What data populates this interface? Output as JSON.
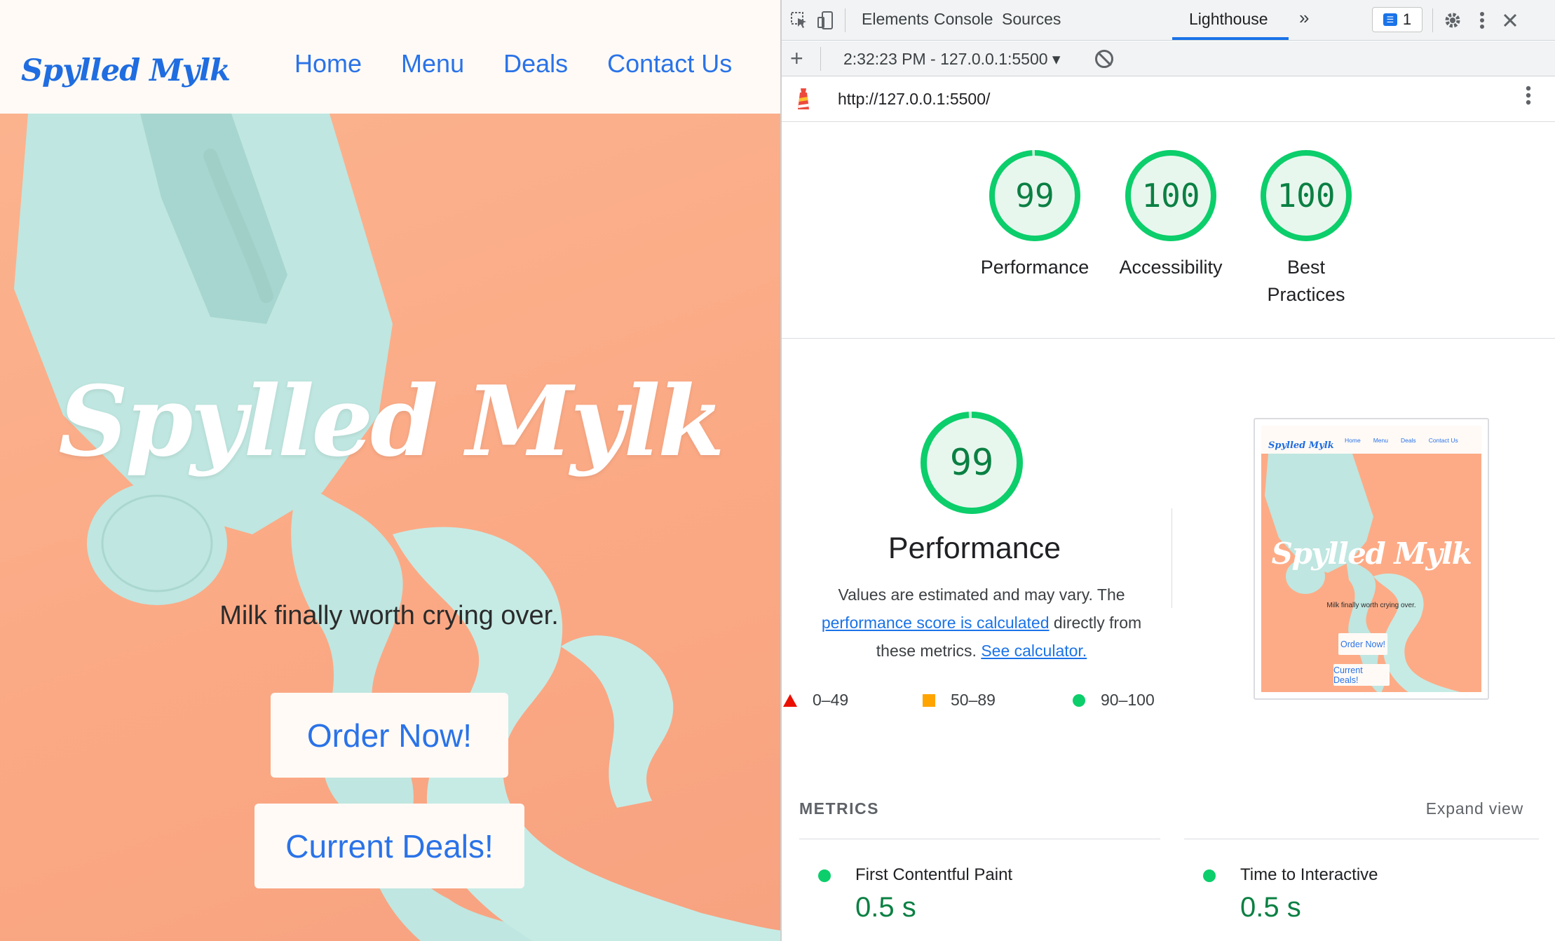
{
  "site": {
    "brand": "Spylled Mylk",
    "nav": [
      "Home",
      "Menu",
      "Deals",
      "Contact Us"
    ],
    "hero_title": "Spylled Mylk",
    "tagline": "Milk finally worth crying over.",
    "cta_order": "Order Now!",
    "cta_deals": "Current Deals!",
    "colors": {
      "brand_blue": "#2a73e8",
      "hero_peach": "#fdab86",
      "milk_blue": "#bfe6e0"
    }
  },
  "devtools": {
    "tabs": [
      "Elements",
      "Console",
      "Sources",
      "Lighthouse"
    ],
    "active_tab": "Lighthouse",
    "more_tabs": "»",
    "issues_count": "1",
    "report_selector": "2:32:23 PM - 127.0.0.1:5500 ▾",
    "url": "http://127.0.0.1:5500/",
    "scores": [
      {
        "label": "Performance",
        "value": "99",
        "fraction": 0.99
      },
      {
        "label": "Accessibility",
        "value": "100",
        "fraction": 1.0
      },
      {
        "label": "Best Practices",
        "value": "100",
        "fraction": 1.0
      }
    ],
    "perf_score": {
      "value": "99",
      "fraction": 0.99
    },
    "perf_title": "Performance",
    "perf_desc_1": "Values are estimated and may vary. The",
    "perf_desc_link1": "performance score is calculated",
    "perf_desc_2": "directly from",
    "perf_desc_3": "these metrics.",
    "perf_desc_link2": "See calculator.",
    "legend": [
      "0–49",
      "50–89",
      "90–100"
    ],
    "thumbnail": {
      "brand": "Spylled Mylk",
      "nav": [
        "Home",
        "Menu",
        "Deals",
        "Contact Us"
      ],
      "hero_title": "Spylled Mylk",
      "tagline": "Milk finally worth crying over.",
      "cta_order": "Order Now!",
      "cta_deals": "Current Deals!"
    },
    "metrics_heading": "METRICS",
    "expand_view": "Expand view",
    "metrics": [
      {
        "name": "First Contentful Paint",
        "value": "0.5 s"
      },
      {
        "name": "Time to Interactive",
        "value": "0.5 s"
      }
    ],
    "colors": {
      "pass_green": "#0cce6b",
      "pass_text": "#0b8043",
      "average": "#ffa400",
      "fail": "#eb0f00",
      "accent": "#1a73e8"
    }
  }
}
